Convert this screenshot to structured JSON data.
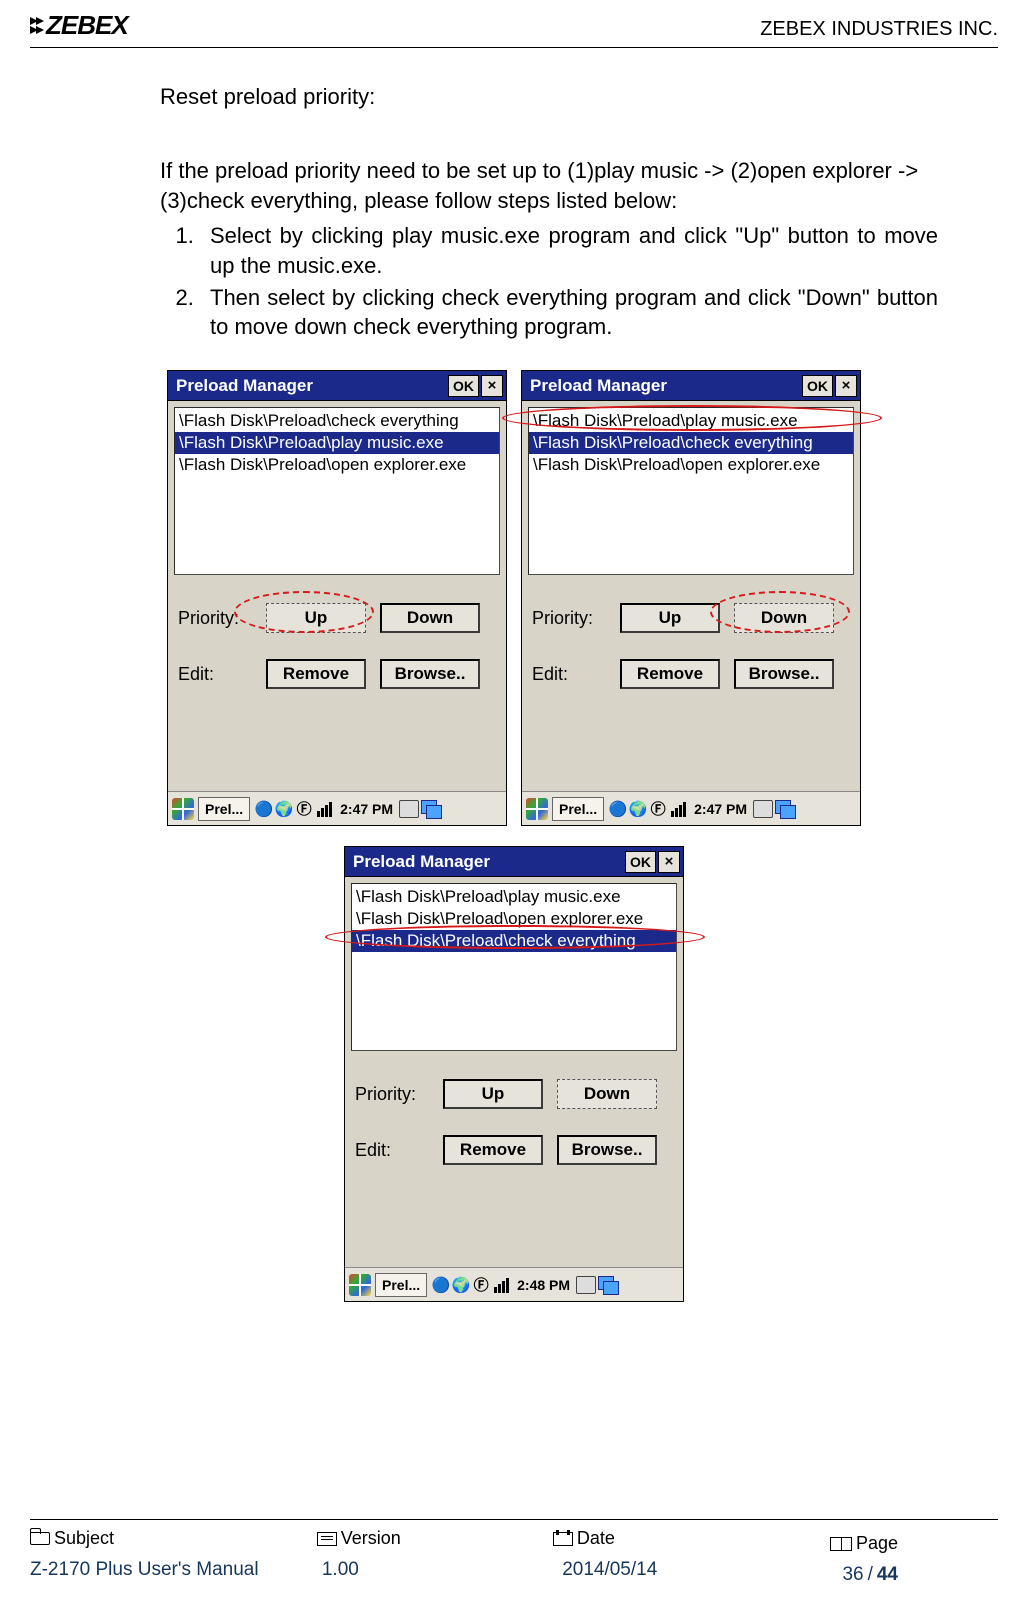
{
  "header": {
    "logo_text": "ZEBEX",
    "company": "ZEBEX INDUSTRIES INC."
  },
  "body": {
    "section_title": "Reset preload priority:",
    "intro": "If the preload priority need to be set up to (1)play music -> (2)open explorer -> (3)check everything, please follow steps listed below:",
    "steps": [
      "Select by clicking play music.exe program and click \"Up\" button to move up the music.exe.",
      "Then select by clicking check everything program and click \"Down\" button to move down check everything program."
    ]
  },
  "pm": {
    "title": "Preload Manager",
    "ok": "OK",
    "close": "×",
    "priority_label": "Priority:",
    "edit_label": "Edit:",
    "up": "Up",
    "down": "Down",
    "remove": "Remove",
    "browse": "Browse..",
    "taskbar_task": "Prel...",
    "time_a": "2:47 PM",
    "time_b": "2:48 PM",
    "screens": {
      "s1": {
        "items": [
          "\\Flash Disk\\Preload\\check everything",
          "\\Flash Disk\\Preload\\play music.exe",
          "\\Flash Disk\\Preload\\open explorer.exe"
        ],
        "selected_index": 1
      },
      "s2": {
        "items": [
          "\\Flash Disk\\Preload\\play music.exe",
          "\\Flash Disk\\Preload\\check everything",
          "\\Flash Disk\\Preload\\open explorer.exe"
        ],
        "selected_index": 1
      },
      "s3": {
        "items": [
          "\\Flash Disk\\Preload\\play music.exe",
          "\\Flash Disk\\Preload\\open explorer.exe",
          "\\Flash Disk\\Preload\\check everything"
        ],
        "selected_index": 2
      }
    }
  },
  "footer": {
    "labels": {
      "subject": "Subject",
      "version": "Version",
      "date": "Date",
      "page": "Page"
    },
    "values": {
      "subject": "Z-2170 Plus User's Manual",
      "version": "1.00",
      "date": "2014/05/14",
      "page_cur": "36",
      "page_sep": " / ",
      "page_total": "44"
    }
  }
}
